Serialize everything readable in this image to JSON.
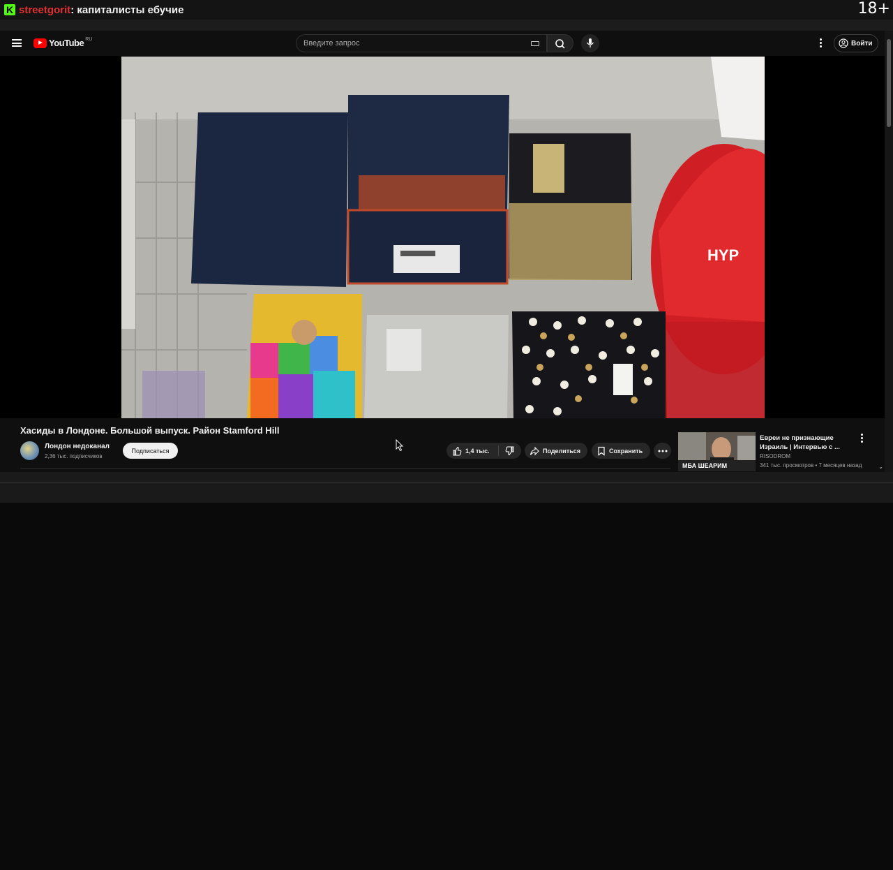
{
  "stream": {
    "channel": "streetgorit",
    "separator": ":",
    "title": " капиталисты ебучие",
    "age_rating": "18+"
  },
  "header": {
    "logo_text": "YouTube",
    "region": "RU",
    "search_placeholder": "Введите запрос",
    "signin_label": "Войти"
  },
  "video": {
    "title": "Хасиды в Лондоне. Большой выпуск. Район Stamford Hill",
    "channel_name": "Лондон недоканал",
    "subscribers": "2,36 тыс. подписчиков",
    "subscribe_label": "Подписаться",
    "likes": "1,4 тыс.",
    "share_label": "Поделиться",
    "save_label": "Сохранить"
  },
  "recommendation": {
    "title": "Евреи не признающие Израиль | Интервью с ...",
    "channel": "RISODROM",
    "meta": "341 тыс. просмотров • 7 месяцев назад",
    "thumb_caption": "МБА ШЕАРИМ"
  },
  "colors": {
    "accent_red": "#ff0000",
    "kick_green": "#53fc18",
    "background": "#0f0f0f"
  }
}
